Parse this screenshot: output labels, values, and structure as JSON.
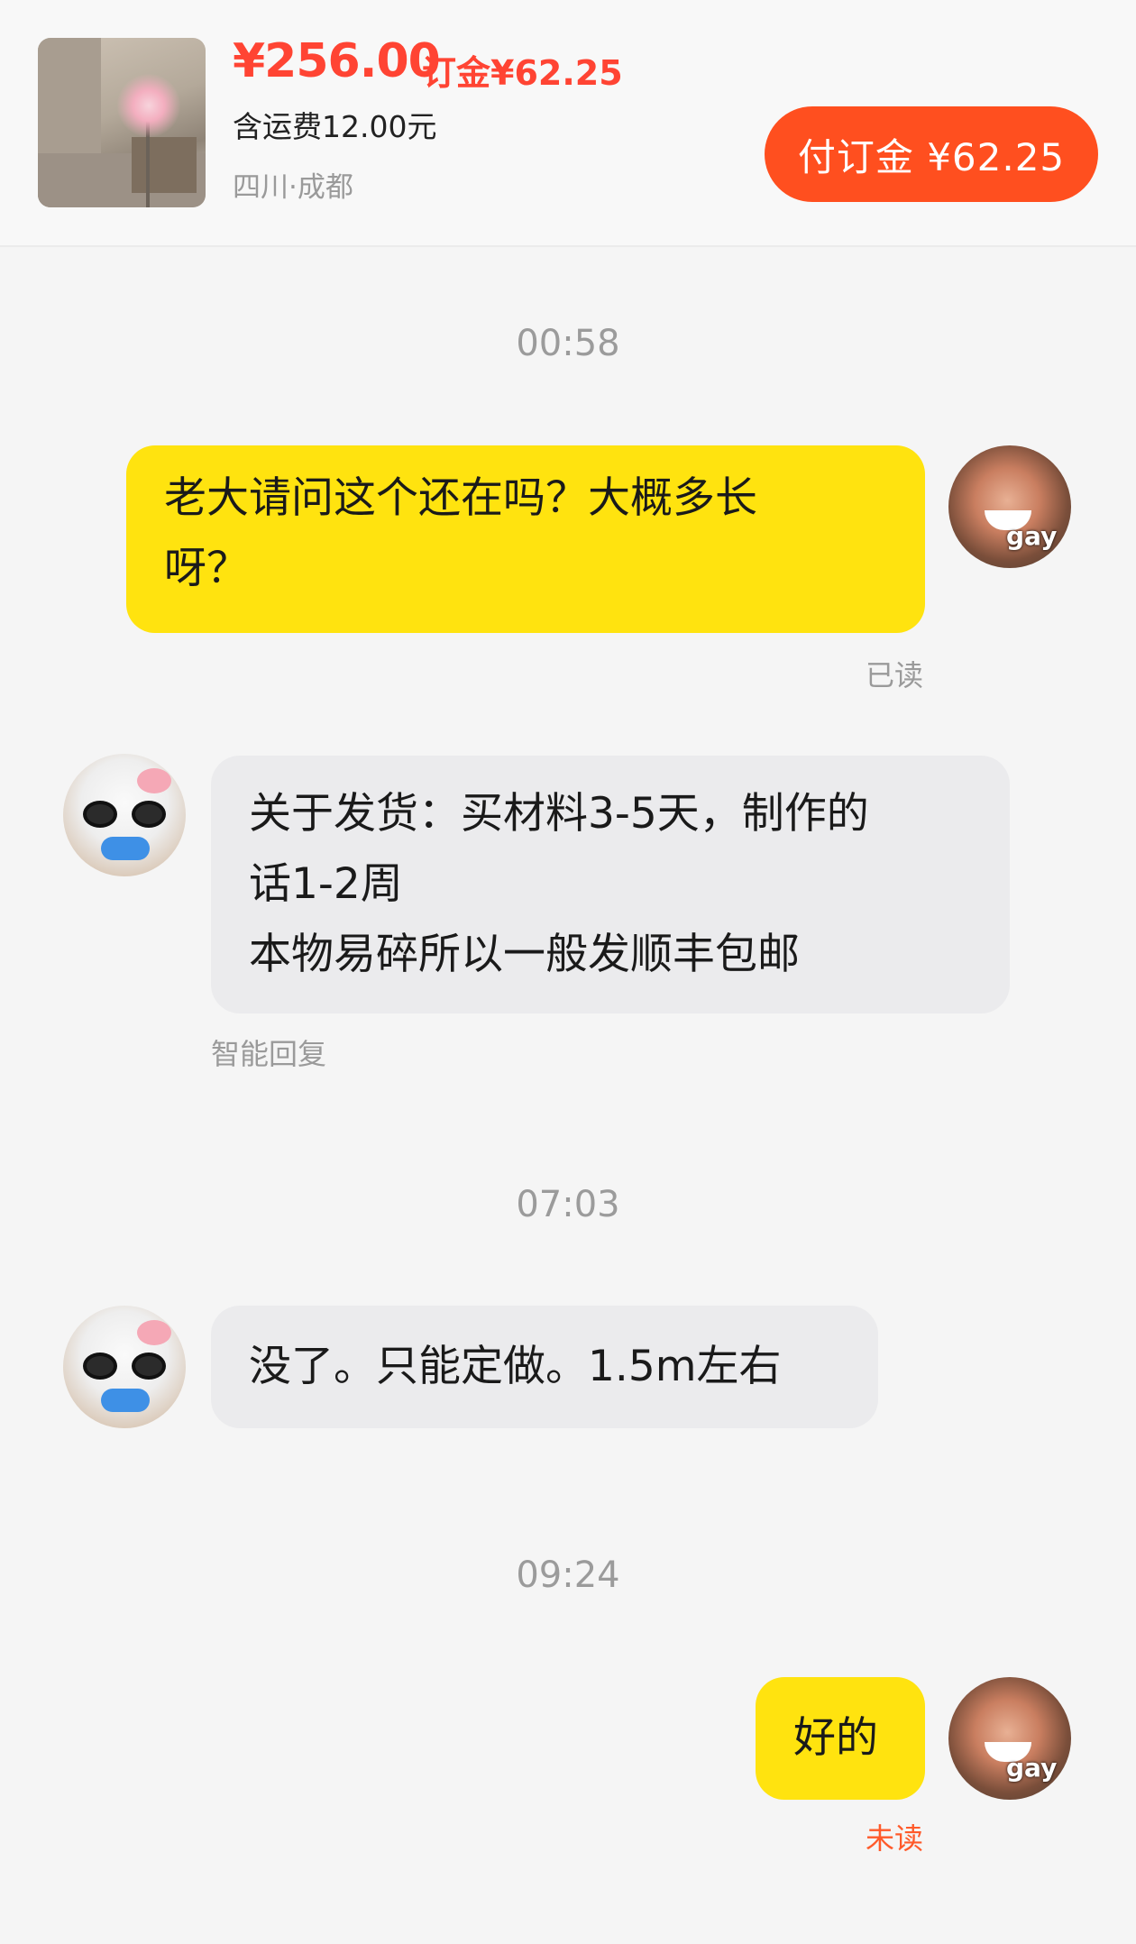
{
  "listing": {
    "price": "¥256.00",
    "deposit_label": "订金¥62.25",
    "shipping": "含运费12.00元",
    "location": "四川·成都",
    "pay_button": "付订金 ¥62.25"
  },
  "avatars": {
    "me_overlay_text": "gay"
  },
  "messages": [
    {
      "timestamp": "00:58"
    },
    {
      "text": "老大请问这个还在吗？大概多长\n呀？",
      "status": "已读"
    },
    {
      "text": "关于发货：买材料3-5天，制作的\n话1-2周\n本物易碎所以一般发顺丰包邮",
      "label": "智能回复"
    },
    {
      "timestamp": "07:03"
    },
    {
      "text": "没了。只能定做。1.5m左右"
    },
    {
      "timestamp": "09:24"
    },
    {
      "text": "好的",
      "status": "未读"
    }
  ],
  "colors": {
    "price": "#ff4433",
    "pay_button": "#ff4f1f",
    "my_bubble": "#ffe30f",
    "their_bubble": "#ebebed",
    "unread": "#ff5a2a"
  }
}
